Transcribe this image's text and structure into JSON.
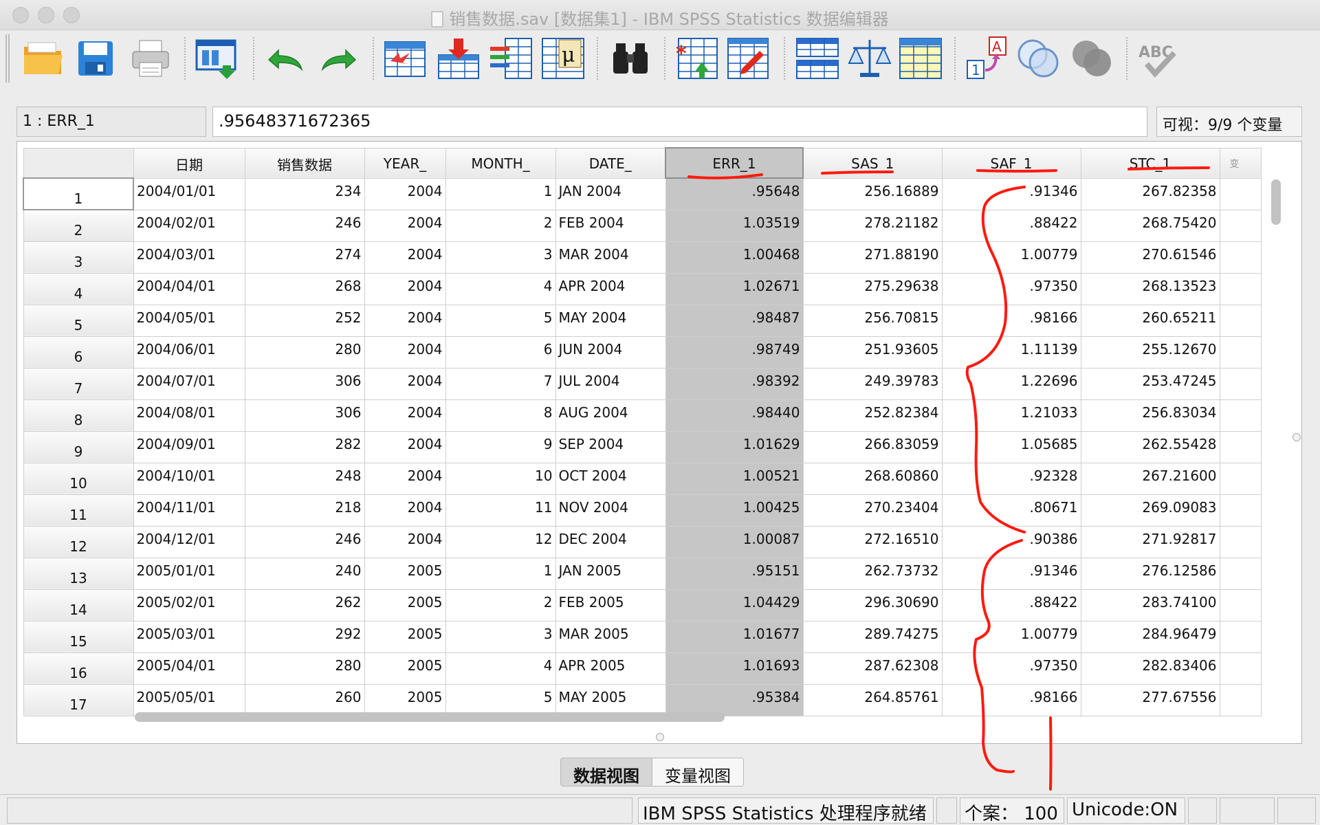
{
  "window": {
    "title": "销售数据.sav [数据集1] - IBM SPSS Statistics 数据编辑器"
  },
  "toolbar": {
    "buttons": [
      "open-folder-icon",
      "save-icon",
      "print-icon",
      "recall-dialog-icon",
      "undo-icon",
      "redo-icon",
      "goto-case-icon",
      "goto-variable-icon",
      "variables-icon",
      "descriptive-stats-icon",
      "find-icon",
      "insert-cases-icon",
      "insert-variable-icon",
      "split-file-icon",
      "weight-cases-icon",
      "select-cases-icon",
      "value-labels-icon",
      "use-variable-sets-icon",
      "show-all-variables-icon",
      "spell-check-icon"
    ]
  },
  "cellbar": {
    "reference": "1 : ERR_1",
    "value": ".95648371672365",
    "visible": "可视：9/9 个变量"
  },
  "grid": {
    "columns": [
      "日期",
      "销售数据",
      "YEAR_",
      "MONTH_",
      "DATE_",
      "ERR_1",
      "SAS_1",
      "SAF_1",
      "STC_1",
      "变"
    ],
    "selected_column": "ERR_1",
    "rows": [
      {
        "n": "1",
        "date": "2004/01/01",
        "sales": "234",
        "year": "2004",
        "month": "1",
        "date_": "JAN 2004",
        "err": ".95648",
        "sas": "256.16889",
        "saf": ".91346",
        "stc": "267.82358"
      },
      {
        "n": "2",
        "date": "2004/02/01",
        "sales": "246",
        "year": "2004",
        "month": "2",
        "date_": "FEB 2004",
        "err": "1.03519",
        "sas": "278.21182",
        "saf": ".88422",
        "stc": "268.75420"
      },
      {
        "n": "3",
        "date": "2004/03/01",
        "sales": "274",
        "year": "2004",
        "month": "3",
        "date_": "MAR 2004",
        "err": "1.00468",
        "sas": "271.88190",
        "saf": "1.00779",
        "stc": "270.61546"
      },
      {
        "n": "4",
        "date": "2004/04/01",
        "sales": "268",
        "year": "2004",
        "month": "4",
        "date_": "APR 2004",
        "err": "1.02671",
        "sas": "275.29638",
        "saf": ".97350",
        "stc": "268.13523"
      },
      {
        "n": "5",
        "date": "2004/05/01",
        "sales": "252",
        "year": "2004",
        "month": "5",
        "date_": "MAY 2004",
        "err": ".98487",
        "sas": "256.70815",
        "saf": ".98166",
        "stc": "260.65211"
      },
      {
        "n": "6",
        "date": "2004/06/01",
        "sales": "280",
        "year": "2004",
        "month": "6",
        "date_": "JUN 2004",
        "err": ".98749",
        "sas": "251.93605",
        "saf": "1.11139",
        "stc": "255.12670"
      },
      {
        "n": "7",
        "date": "2004/07/01",
        "sales": "306",
        "year": "2004",
        "month": "7",
        "date_": "JUL 2004",
        "err": ".98392",
        "sas": "249.39783",
        "saf": "1.22696",
        "stc": "253.47245"
      },
      {
        "n": "8",
        "date": "2004/08/01",
        "sales": "306",
        "year": "2004",
        "month": "8",
        "date_": "AUG 2004",
        "err": ".98440",
        "sas": "252.82384",
        "saf": "1.21033",
        "stc": "256.83034"
      },
      {
        "n": "9",
        "date": "2004/09/01",
        "sales": "282",
        "year": "2004",
        "month": "9",
        "date_": "SEP 2004",
        "err": "1.01629",
        "sas": "266.83059",
        "saf": "1.05685",
        "stc": "262.55428"
      },
      {
        "n": "10",
        "date": "2004/10/01",
        "sales": "248",
        "year": "2004",
        "month": "10",
        "date_": "OCT 2004",
        "err": "1.00521",
        "sas": "268.60860",
        "saf": ".92328",
        "stc": "267.21600"
      },
      {
        "n": "11",
        "date": "2004/11/01",
        "sales": "218",
        "year": "2004",
        "month": "11",
        "date_": "NOV 2004",
        "err": "1.00425",
        "sas": "270.23404",
        "saf": ".80671",
        "stc": "269.09083"
      },
      {
        "n": "12",
        "date": "2004/12/01",
        "sales": "246",
        "year": "2004",
        "month": "12",
        "date_": "DEC 2004",
        "err": "1.00087",
        "sas": "272.16510",
        "saf": ".90386",
        "stc": "271.92817"
      },
      {
        "n": "13",
        "date": "2005/01/01",
        "sales": "240",
        "year": "2005",
        "month": "1",
        "date_": "JAN 2005",
        "err": ".95151",
        "sas": "262.73732",
        "saf": ".91346",
        "stc": "276.12586"
      },
      {
        "n": "14",
        "date": "2005/02/01",
        "sales": "262",
        "year": "2005",
        "month": "2",
        "date_": "FEB 2005",
        "err": "1.04429",
        "sas": "296.30690",
        "saf": ".88422",
        "stc": "283.74100"
      },
      {
        "n": "15",
        "date": "2005/03/01",
        "sales": "292",
        "year": "2005",
        "month": "3",
        "date_": "MAR 2005",
        "err": "1.01677",
        "sas": "289.74275",
        "saf": "1.00779",
        "stc": "284.96479"
      },
      {
        "n": "16",
        "date": "2005/04/01",
        "sales": "280",
        "year": "2005",
        "month": "4",
        "date_": "APR 2005",
        "err": "1.01693",
        "sas": "287.62308",
        "saf": ".97350",
        "stc": "282.83406"
      },
      {
        "n": "17",
        "date": "2005/05/01",
        "sales": "260",
        "year": "2005",
        "month": "5",
        "date_": "MAY 2005",
        "err": ".95384",
        "sas": "264.85761",
        "saf": ".98166",
        "stc": "277.67556"
      }
    ]
  },
  "view_tabs": {
    "data_view": "数据视图",
    "variable_view": "变量视图",
    "active": "数据视图"
  },
  "statusbar": {
    "processor": "IBM SPSS Statistics 处理程序就绪",
    "cases": "个案：  100",
    "unicode": "Unicode:ON"
  },
  "colors": {
    "annotation": "#ff1a0e",
    "selected_column": "#c6c6c6"
  }
}
